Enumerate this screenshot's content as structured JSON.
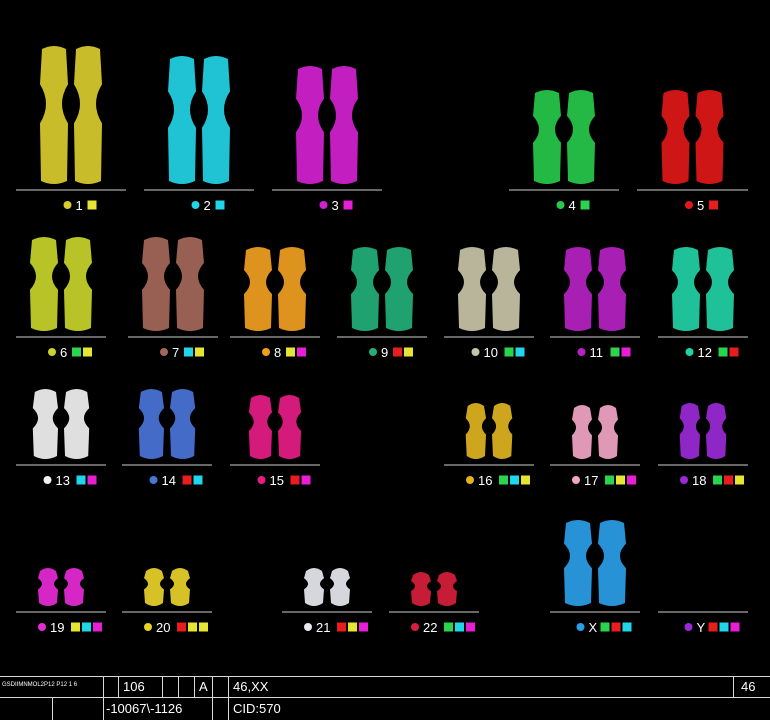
{
  "colors": {
    "yellow": "#e6e632",
    "cyan": "#1fd6ea",
    "magenta": "#e61ed6",
    "green": "#2bd34f",
    "red": "#e81e1e"
  },
  "chromosomes": [
    {
      "label": "1",
      "color": "#d9cc2e",
      "codes": [
        "yellow"
      ]
    },
    {
      "label": "2",
      "color": "#23d4e6",
      "codes": [
        "cyan"
      ]
    },
    {
      "label": "3",
      "color": "#d421d0",
      "codes": [
        "magenta"
      ]
    },
    {
      "label": "4",
      "color": "#27c94a",
      "codes": [
        "green"
      ]
    },
    {
      "label": "5",
      "color": "#e01818",
      "codes": [
        "red"
      ]
    },
    {
      "label": "6",
      "color": "#c8d42a",
      "codes": [
        "green",
        "yellow"
      ]
    },
    {
      "label": "7",
      "color": "#a5675a",
      "codes": [
        "cyan",
        "yellow"
      ]
    },
    {
      "label": "8",
      "color": "#f0a020",
      "codes": [
        "yellow",
        "magenta"
      ]
    },
    {
      "label": "9",
      "color": "#22b07a",
      "codes": [
        "red",
        "yellow"
      ]
    },
    {
      "label": "10",
      "color": "#c9c4a8",
      "codes": [
        "green",
        "cyan"
      ]
    },
    {
      "label": "11",
      "color": "#b522c2",
      "codes": [
        "green",
        "magenta"
      ]
    },
    {
      "label": "12",
      "color": "#22d1a6",
      "codes": [
        "green",
        "red"
      ]
    },
    {
      "label": "13",
      "color": "#f2f2f2",
      "codes": [
        "cyan",
        "magenta"
      ]
    },
    {
      "label": "14",
      "color": "#4a74d8",
      "codes": [
        "red",
        "cyan"
      ]
    },
    {
      "label": "15",
      "color": "#e61c86",
      "codes": [
        "red",
        "magenta"
      ]
    },
    {
      "label": "16",
      "color": "#e0b420",
      "codes": [
        "green",
        "cyan",
        "yellow"
      ]
    },
    {
      "label": "17",
      "color": "#f2a6c6",
      "codes": [
        "green",
        "yellow",
        "magenta"
      ]
    },
    {
      "label": "18",
      "color": "#9a2ad6",
      "codes": [
        "green",
        "red",
        "yellow"
      ]
    },
    {
      "label": "19",
      "color": "#e62ad6",
      "codes": [
        "yellow",
        "cyan",
        "magenta"
      ]
    },
    {
      "label": "20",
      "color": "#e8d22a",
      "codes": [
        "red",
        "yellow",
        "yellow"
      ]
    },
    {
      "label": "21",
      "color": "#e8e8f0",
      "codes": [
        "red",
        "yellow",
        "magenta"
      ]
    },
    {
      "label": "22",
      "color": "#d81e3a",
      "codes": [
        "green",
        "cyan",
        "magenta"
      ]
    },
    {
      "label": "X",
      "color": "#2a9ee8",
      "codes": [
        "green",
        "red",
        "cyan"
      ]
    },
    {
      "label": "Y",
      "color": "#9a2ad6",
      "codes": [
        "red",
        "cyan",
        "magenta"
      ]
    }
  ],
  "status_bar": {
    "id_text": "GSDIIMNMOL2P12 P12 1 6",
    "field_number": "106",
    "field_a": "A",
    "karyotype": "46,XX",
    "count": "46",
    "coords": "-10067\\-1126",
    "cid": "CID:570"
  }
}
